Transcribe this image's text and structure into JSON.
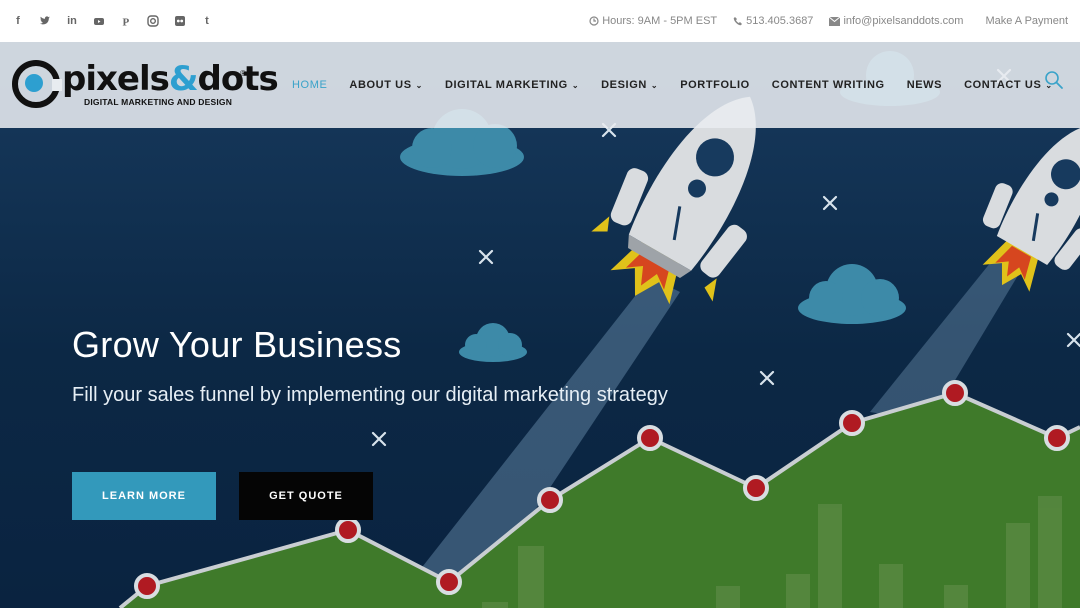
{
  "topbar": {
    "social_icons": [
      "facebook-icon",
      "twitter-icon",
      "linkedin-icon",
      "youtube-icon",
      "pinterest-icon",
      "instagram-icon",
      "flickr-icon",
      "tumblr-icon"
    ],
    "hours": "Hours: 9AM - 5PM EST",
    "phone": "513.405.3687",
    "email": "info@pixelsanddots.com",
    "payment": "Make A Payment"
  },
  "logo": {
    "name_part1": "pixels",
    "name_amp": "&",
    "name_part2": "dots",
    "registered": "®",
    "tagline": "DIGITAL MARKETING AND DESIGN"
  },
  "nav": {
    "items": [
      {
        "label": "HOME",
        "active": true,
        "dropdown": false
      },
      {
        "label": "ABOUT US",
        "active": false,
        "dropdown": true
      },
      {
        "label": "DIGITAL MARKETING",
        "active": false,
        "dropdown": true
      },
      {
        "label": "DESIGN",
        "active": false,
        "dropdown": true
      },
      {
        "label": "PORTFOLIO",
        "active": false,
        "dropdown": false
      },
      {
        "label": "CONTENT WRITING",
        "active": false,
        "dropdown": false
      },
      {
        "label": "NEWS",
        "active": false,
        "dropdown": false
      },
      {
        "label": "CONTACT US",
        "active": false,
        "dropdown": true
      }
    ]
  },
  "hero": {
    "title": "Grow Your Business",
    "subtitle": "Fill your sales funnel by implementing our digital marketing strategy",
    "learn_more": "LEARN MORE",
    "get_quote": "GET QUOTE"
  },
  "colors": {
    "accent": "#3aa3c9",
    "button_primary": "#3399bb",
    "button_dark": "#050505",
    "hero_bg": "#0c2845",
    "hill_green": "#3f7a2a",
    "marker_red": "#b01a22"
  }
}
